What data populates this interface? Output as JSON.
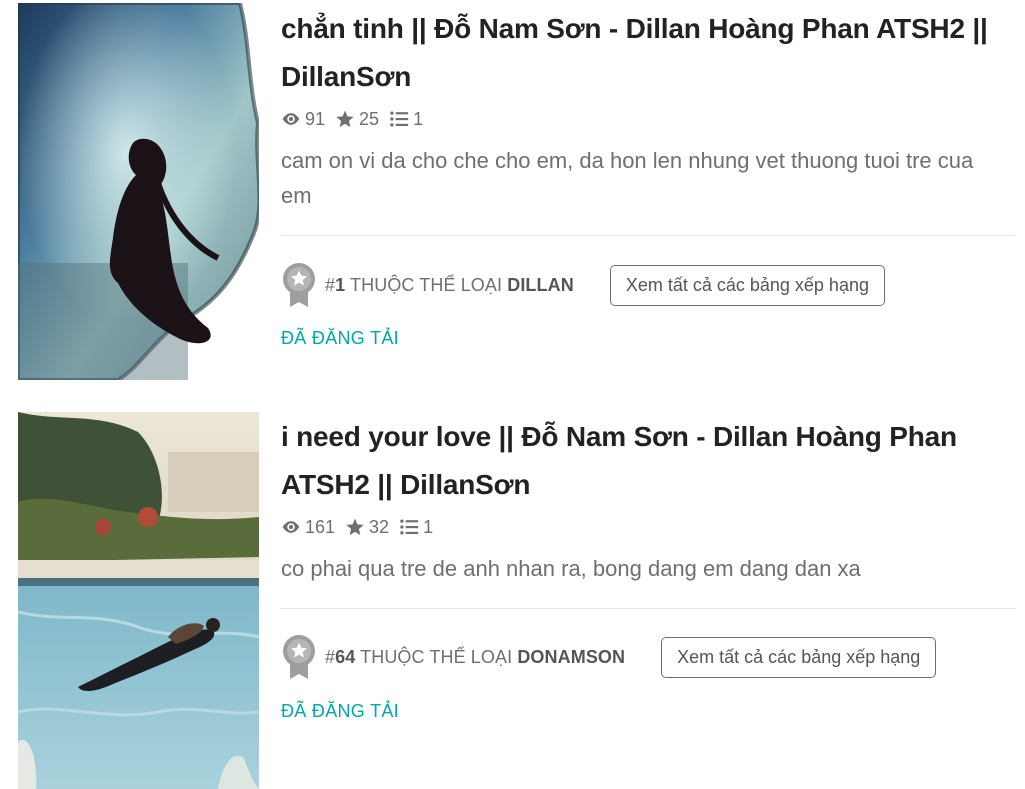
{
  "stories": [
    {
      "title": "chẳn tinh || Đỗ Nam Sơn - Dillan Hoàng Phan ATSH2 || DillanSơn",
      "reads": "91",
      "votes": "25",
      "parts": "1",
      "description": "cam on vi da cho che cho em, da hon len nhung vet thuong tuoi tre cua em",
      "rank": {
        "hash": "#",
        "number": "1",
        "mid": " THUỘC THỂ LOẠI ",
        "category": "DILLAN"
      },
      "rank_button_label": "Xem tất cả các bảng xếp hạng",
      "status": "ĐÃ ĐĂNG TẢI",
      "cover_icon": "cover-image"
    },
    {
      "title": "i need your love || Đỗ Nam Sơn - Dillan Hoàng Phan ATSH2 || DillanSơn",
      "reads": "161",
      "votes": "32",
      "parts": "1",
      "description": "co phai qua tre de anh nhan ra, bong dang em dang dan xa",
      "rank": {
        "hash": "#",
        "number": "64",
        "mid": " THUỘC THỂ LOẠI ",
        "category": "DONAMSON"
      },
      "rank_button_label": "Xem tất cả các bảng xếp hạng",
      "status": "ĐÃ ĐĂNG TẢI",
      "cover_icon": "cover-image"
    }
  ],
  "icons": {
    "reads": "eye-icon",
    "votes": "star-icon",
    "parts": "list-icon",
    "rank": "ranking-badge-icon"
  },
  "colors": {
    "title": "#222222",
    "meta": "#6f6f6f",
    "status": "#00a8a8",
    "divider": "#e6e6e6",
    "badge": "#9e9e9e"
  }
}
